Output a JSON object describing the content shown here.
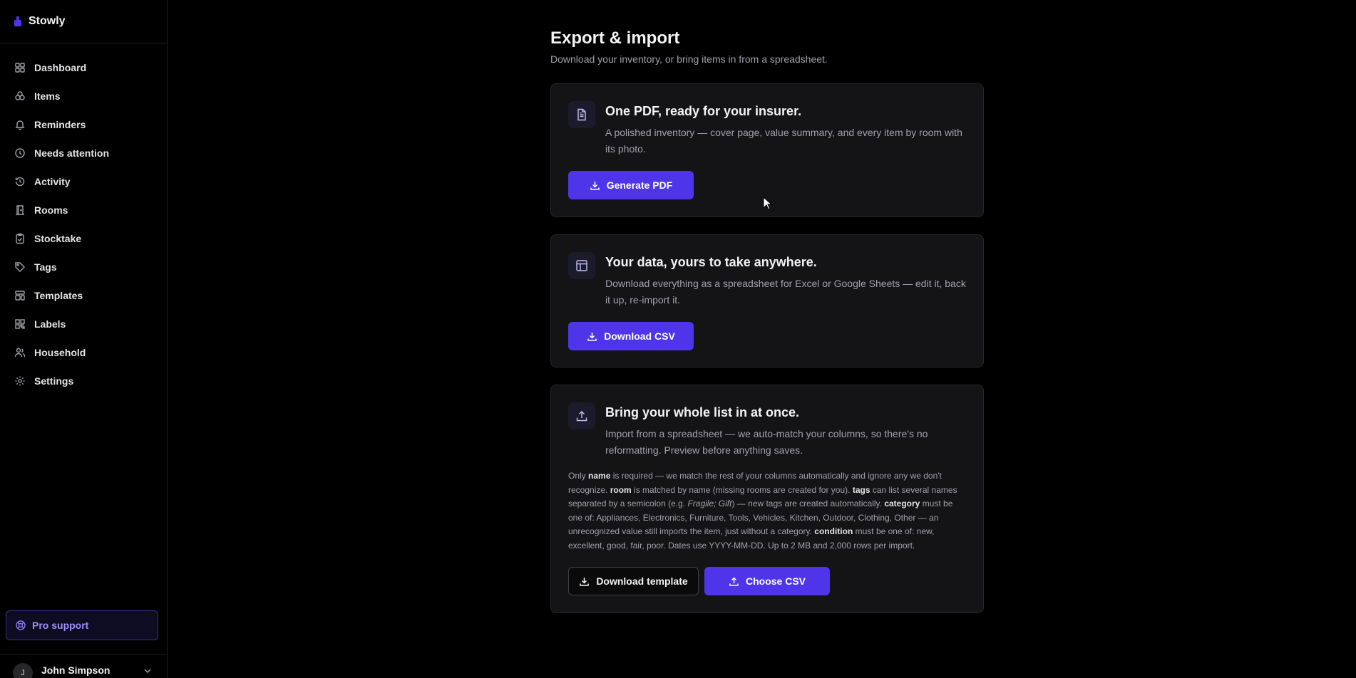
{
  "brand": {
    "name": "Stowly",
    "accent": "#4f35ea"
  },
  "sidebar": {
    "items": [
      {
        "label": "Dashboard",
        "icon": "dashboard-icon"
      },
      {
        "label": "Items",
        "icon": "items-icon"
      },
      {
        "label": "Reminders",
        "icon": "bell-icon"
      },
      {
        "label": "Needs attention",
        "icon": "clock-icon"
      },
      {
        "label": "Activity",
        "icon": "history-icon"
      },
      {
        "label": "Rooms",
        "icon": "door-icon"
      },
      {
        "label": "Stocktake",
        "icon": "clipboard-check-icon"
      },
      {
        "label": "Tags",
        "icon": "tag-icon"
      },
      {
        "label": "Templates",
        "icon": "layout-template-icon"
      },
      {
        "label": "Labels",
        "icon": "qr-code-icon"
      },
      {
        "label": "Household",
        "icon": "users-icon"
      },
      {
        "label": "Settings",
        "icon": "gear-icon"
      }
    ],
    "pro_support": "Pro support",
    "user": {
      "name": "John Simpson",
      "initial": "J"
    }
  },
  "page": {
    "title": "Export & import",
    "subtitle": "Download your inventory, or bring items in from a spreadsheet."
  },
  "cards": {
    "pdf": {
      "title": "One PDF, ready for your insurer.",
      "description": "A polished inventory — cover page, value summary, and every item by room with its photo.",
      "button": "Generate PDF"
    },
    "csv": {
      "title": "Your data, yours to take anywhere.",
      "description": "Download everything as a spreadsheet for Excel or Google Sheets — edit it, back it up, re-import it.",
      "button": "Download CSV"
    },
    "import": {
      "title": "Bring your whole list in at once.",
      "description": "Import from a spreadsheet — we auto-match your columns, so there's no reformatting. Preview before anything saves.",
      "help": {
        "t1": "Only ",
        "b1": "name",
        "t2": " is required — we match the rest of your columns automatically and ignore any we don't recognize. ",
        "b2": "room",
        "t3": " is matched by name (missing rooms are created for you). ",
        "b3": "tags",
        "t4": " can list several names separated by a semicolon (e.g. ",
        "i1": "Fragile; Gift",
        "t5": ") — new tags are created automatically. ",
        "b4": "category",
        "t6": " must be one of: Appliances, Electronics, Furniture, Tools, Vehicles, Kitchen, Outdoor, Clothing, Other — an unrecognized value still imports the item, just without a category. ",
        "b5": "condition",
        "t7": " must be one of: new, excellent, good, fair, poor. Dates use YYYY-MM-DD. Up to 2 MB and 2,000 rows per import."
      },
      "template_button": "Download template",
      "choose_button": "Choose CSV"
    }
  }
}
